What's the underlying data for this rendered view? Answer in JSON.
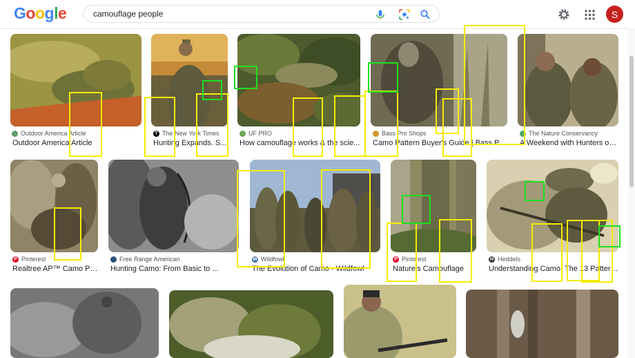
{
  "header": {
    "logo_letters": [
      "G",
      "o",
      "o",
      "g",
      "l",
      "e"
    ],
    "logo_colors": [
      "#4285f4",
      "#ea4335",
      "#fbbc05",
      "#4285f4",
      "#34a853",
      "#ea4335"
    ],
    "search_query": "camouflage people",
    "avatar_letter": "S",
    "avatar_color": "#c5221f"
  },
  "icons": {
    "mic": "microphone-icon",
    "lens": "lens-icon",
    "search": "search-icon",
    "settings": "gear-icon",
    "apps": "apps-grid-icon"
  },
  "results": {
    "row1": [
      {
        "source": "Outdoor America Article",
        "title": "Outdoor America Article",
        "favicon_color": "#5f9e6e",
        "favicon_glyph": ""
      },
      {
        "source": "The New York Times",
        "title": "Hunting Expands. S...",
        "favicon_color": "#000000",
        "favicon_glyph": "T"
      },
      {
        "source": "UF PRO",
        "title": "How camouflage works & the scie...",
        "favicon_color": "#6aa84f",
        "favicon_glyph": ""
      },
      {
        "source": "Bass Pro Shops",
        "title": "Camo Pattern Buyer's Guide | Bass Pro...",
        "favicon_color": "#d39a2a",
        "favicon_glyph": ""
      },
      {
        "source": "The Nature Conservancy",
        "title": "A Weekend with Hunters of ...",
        "favicon_color": "#48a868",
        "favicon_glyph": ""
      }
    ],
    "row2": [
      {
        "source": "Pinterest",
        "title": "Realtree AP™ Camo Pa...",
        "favicon_color": "#e60023",
        "favicon_glyph": "P"
      },
      {
        "source": "Free Range American",
        "title": "Hunting Camo: From Basic to ...",
        "favicon_color": "#2b4f7e",
        "favicon_glyph": ""
      },
      {
        "source": "Wildfowl",
        "title": "The Evolution of Camo - Wildfowl",
        "favicon_color": "#3b6ea5",
        "favicon_glyph": "W"
      },
      {
        "source": "Pinterest",
        "title": "Nature's Camouflage",
        "favicon_color": "#e60023",
        "favicon_glyph": "P"
      },
      {
        "source": "Heddels",
        "title": "Understanding Camo: The 13 Pattern...",
        "favicon_color": "#333333",
        "favicon_glyph": "H"
      }
    ]
  }
}
